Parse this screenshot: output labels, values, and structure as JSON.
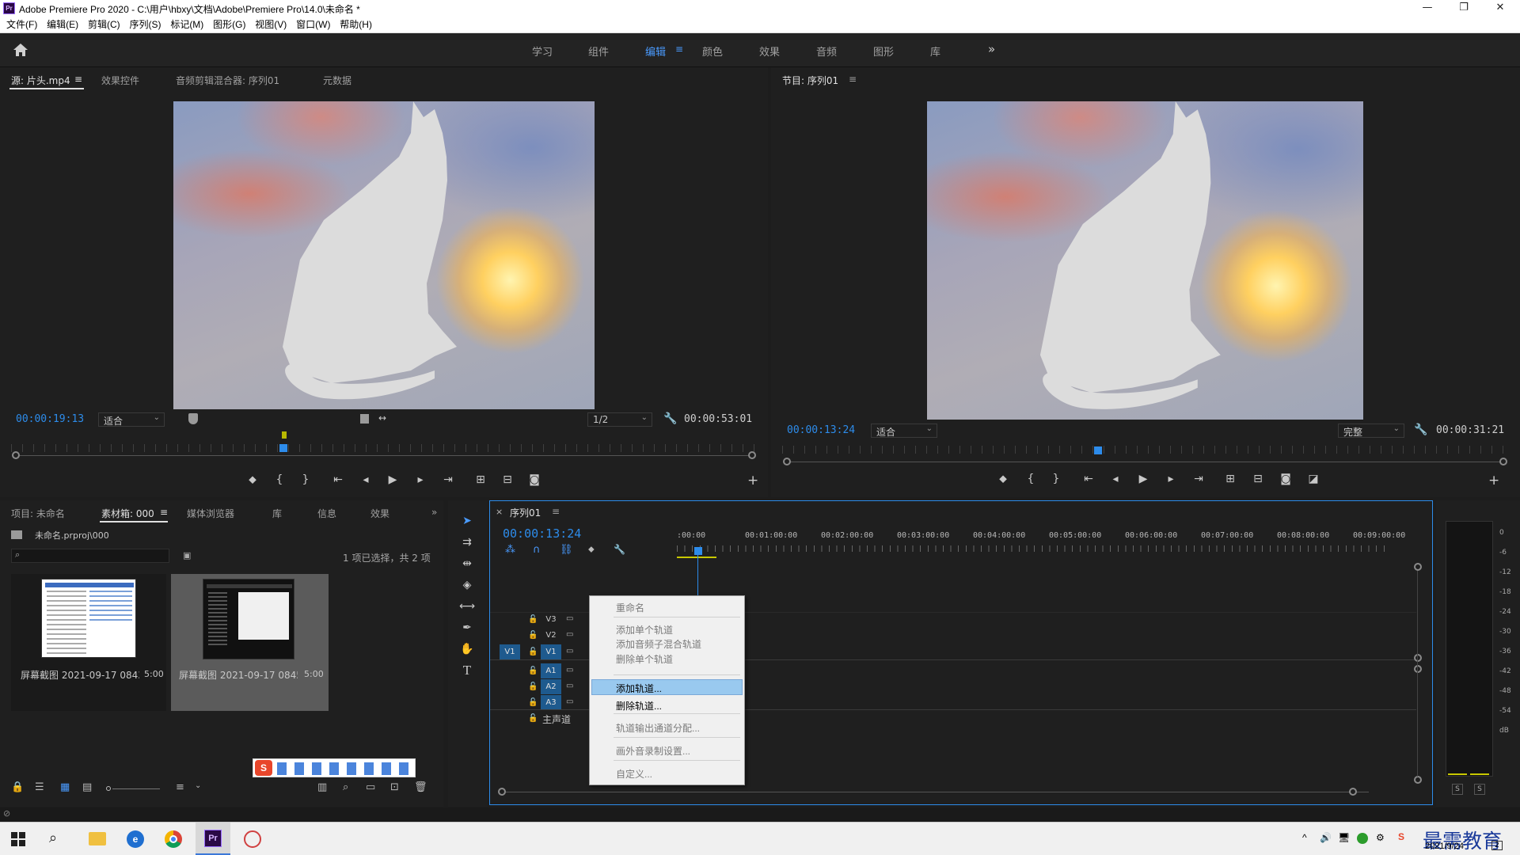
{
  "window": {
    "title": "Adobe Premiere Pro 2020 - C:\\用户\\hbxy\\文档\\Adobe\\Premiere Pro\\14.0\\未命名 *",
    "app_icon": "Pr",
    "minimize": "—",
    "maximize": "❐",
    "close": "✕"
  },
  "menubar": {
    "items": [
      "文件(F)",
      "编辑(E)",
      "剪辑(C)",
      "序列(S)",
      "标记(M)",
      "图形(G)",
      "视图(V)",
      "窗口(W)",
      "帮助(H)"
    ]
  },
  "workspaces": {
    "tabs": [
      "学习",
      "组件",
      "编辑",
      "颜色",
      "效果",
      "音频",
      "图形",
      "库"
    ],
    "active": "编辑",
    "more": "»"
  },
  "source_panel": {
    "tabs": [
      "源: 片头.mp4",
      "效果控件",
      "音频剪辑混合器: 序列01",
      "元数据"
    ],
    "menu_icon": "≡",
    "timecode": "00:00:19:13",
    "fit_value": "适合",
    "resolution": "1/2",
    "duration": "00:00:53:01"
  },
  "program_panel": {
    "title": "节目: 序列01",
    "menu_icon": "≡",
    "timecode": "00:00:13:24",
    "fit_value": "适合",
    "quality": "完整",
    "duration": "00:00:31:21"
  },
  "project_panel": {
    "tabs": [
      "项目: 未命名",
      "素材箱: 000",
      "媒体浏览器",
      "库",
      "信息",
      "效果"
    ],
    "menu_icon": "≡",
    "more": "»",
    "path": "未命名.prproj\\000",
    "selection_info": "1 项已选择，共 2 项",
    "search_placeholder": "",
    "items": [
      {
        "name": "屏幕截图 2021-09-17 0843...",
        "duration": "5:00"
      },
      {
        "name": "屏幕截图 2021-09-17 0845...",
        "duration": "5:00"
      }
    ]
  },
  "timeline": {
    "tab": "序列01",
    "close": "×",
    "menu_icon": "≡",
    "timecode": "00:00:13:24",
    "ruler": [
      ":00:00",
      "00:01:00:00",
      "00:02:00:00",
      "00:03:00:00",
      "00:04:00:00",
      "00:05:00:00",
      "00:06:00:00",
      "00:07:00:00",
      "00:08:00:00",
      "00:09:00:00"
    ],
    "tracks": [
      {
        "label": "V3",
        "source": ""
      },
      {
        "label": "V2",
        "source": ""
      },
      {
        "label": "V1",
        "source": "V1"
      },
      {
        "label": "A1",
        "source": ""
      },
      {
        "label": "A2",
        "source": ""
      },
      {
        "label": "A3",
        "source": ""
      }
    ],
    "master": "主声道"
  },
  "context_menu": {
    "items": [
      "重命名",
      "添加单个轨道",
      "添加音频子混合轨道",
      "删除单个轨道",
      "添加轨道...",
      "删除轨道...",
      "轨道输出通道分配...",
      "画外音录制设置...",
      "自定义..."
    ],
    "highlighted": "添加轨道..."
  },
  "audio_meter": {
    "scale": [
      "0",
      "-6",
      "-12",
      "-18",
      "-24",
      "-30",
      "-36",
      "-42",
      "-48",
      "-54",
      "dB"
    ],
    "solo": [
      "S",
      "S"
    ]
  },
  "taskbar": {
    "date": "2021/9/24",
    "watermark": "最需教育",
    "notification_count": "2"
  },
  "colors": {
    "accent": "#2d8ceb",
    "panel_bg": "#1f1f1f",
    "highlight": "#99c9ef",
    "playhead": "#2d8ceb"
  }
}
